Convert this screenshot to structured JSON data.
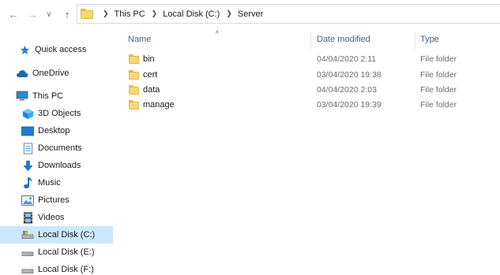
{
  "breadcrumb": [
    "This PC",
    "Local Disk (C:)",
    "Server"
  ],
  "sidebar": {
    "items": [
      {
        "label": "Quick access",
        "icon": "star-icon"
      },
      {
        "label": "OneDrive",
        "icon": "cloud-icon"
      },
      {
        "label": "This PC",
        "icon": "computer-icon"
      },
      {
        "label": "3D Objects",
        "icon": "cube-icon"
      },
      {
        "label": "Desktop",
        "icon": "desktop-icon"
      },
      {
        "label": "Documents",
        "icon": "document-icon"
      },
      {
        "label": "Downloads",
        "icon": "download-arrow-icon"
      },
      {
        "label": "Music",
        "icon": "music-note-icon"
      },
      {
        "label": "Pictures",
        "icon": "picture-icon"
      },
      {
        "label": "Videos",
        "icon": "film-icon"
      },
      {
        "label": "Local Disk (C:)",
        "icon": "drive-icon",
        "selected": true
      },
      {
        "label": "Local Disk (E:)",
        "icon": "drive-icon"
      },
      {
        "label": "Local Disk (F:)",
        "icon": "drive-icon"
      }
    ]
  },
  "columns": {
    "name": "Name",
    "date": "Date modified",
    "type": "Type"
  },
  "files": [
    {
      "name": "bin",
      "date": "04/04/2020 2:11",
      "type": "File folder"
    },
    {
      "name": "cert",
      "date": "03/04/2020 19:38",
      "type": "File folder"
    },
    {
      "name": "data",
      "date": "04/04/2020 2:03",
      "type": "File folder"
    },
    {
      "name": "manage",
      "date": "03/04/2020 19:39",
      "type": "File folder"
    }
  ],
  "colors": {
    "selected_bg": "#cce8ff",
    "folder_yellow": "#f8d775",
    "header_text": "#4c607a"
  }
}
